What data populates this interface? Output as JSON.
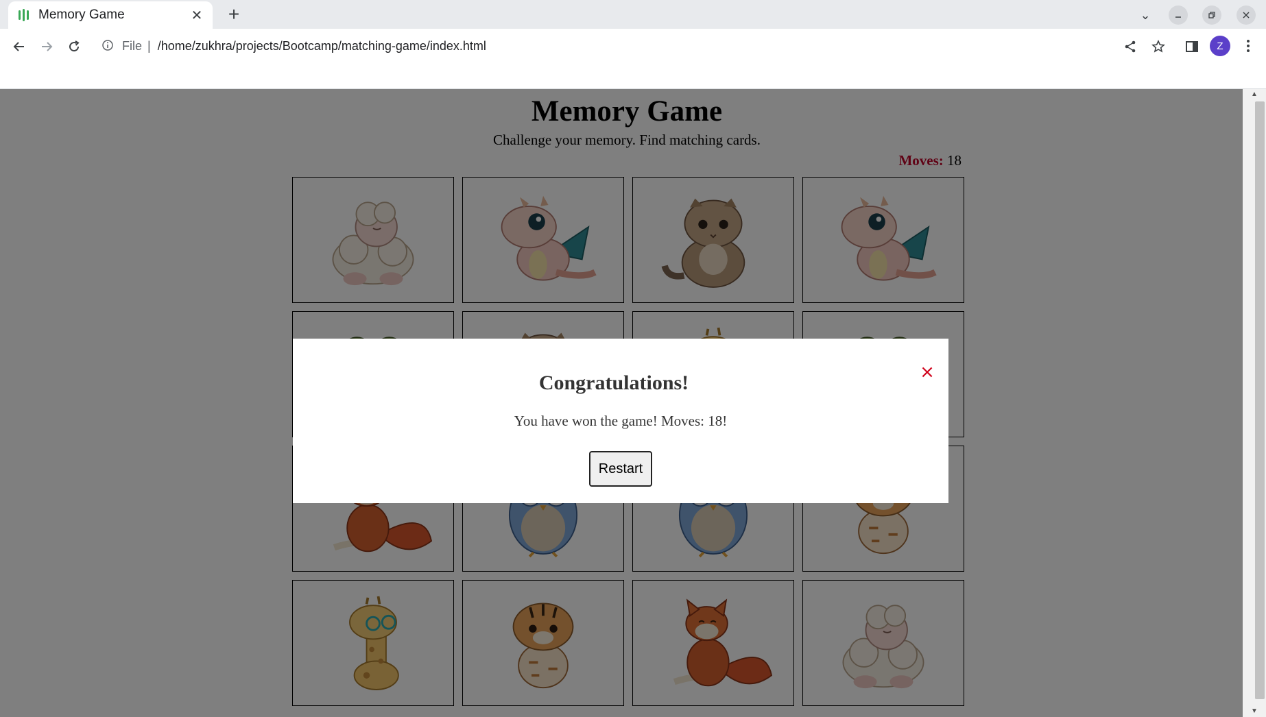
{
  "browser": {
    "tab_title": "Memory Game",
    "address_scheme": "File",
    "address_url": "/home/zukhra/projects/Bootcamp/matching-game/index.html",
    "profile_initial": "Z"
  },
  "game": {
    "title": "Memory Game",
    "subtitle": "Challenge your memory. Find matching cards.",
    "moves_label": "Moves:",
    "moves_value": "18",
    "cards": [
      {
        "animal": "sheep-icon"
      },
      {
        "animal": "dragon-icon"
      },
      {
        "animal": "cat-icon"
      },
      {
        "animal": "dragon-icon"
      },
      {
        "animal": "frog-icon"
      },
      {
        "animal": "cat-icon"
      },
      {
        "animal": "giraffe-icon"
      },
      {
        "animal": "frog-icon"
      },
      {
        "animal": "fox-icon"
      },
      {
        "animal": "owl-icon"
      },
      {
        "animal": "owl-icon"
      },
      {
        "animal": "tiger-icon"
      },
      {
        "animal": "giraffe-icon"
      },
      {
        "animal": "tiger-icon"
      },
      {
        "animal": "fox-icon"
      },
      {
        "animal": "sheep-icon"
      }
    ]
  },
  "modal": {
    "title": "Congratulations!",
    "message": "You have won the game! Moves: 18!",
    "close_symbol": "×",
    "restart_label": "Restart"
  },
  "colors": {
    "moves_label": "#c0042a",
    "overlay": "rgba(0,0,0,0.5)",
    "close_icon": "#d0021b"
  }
}
